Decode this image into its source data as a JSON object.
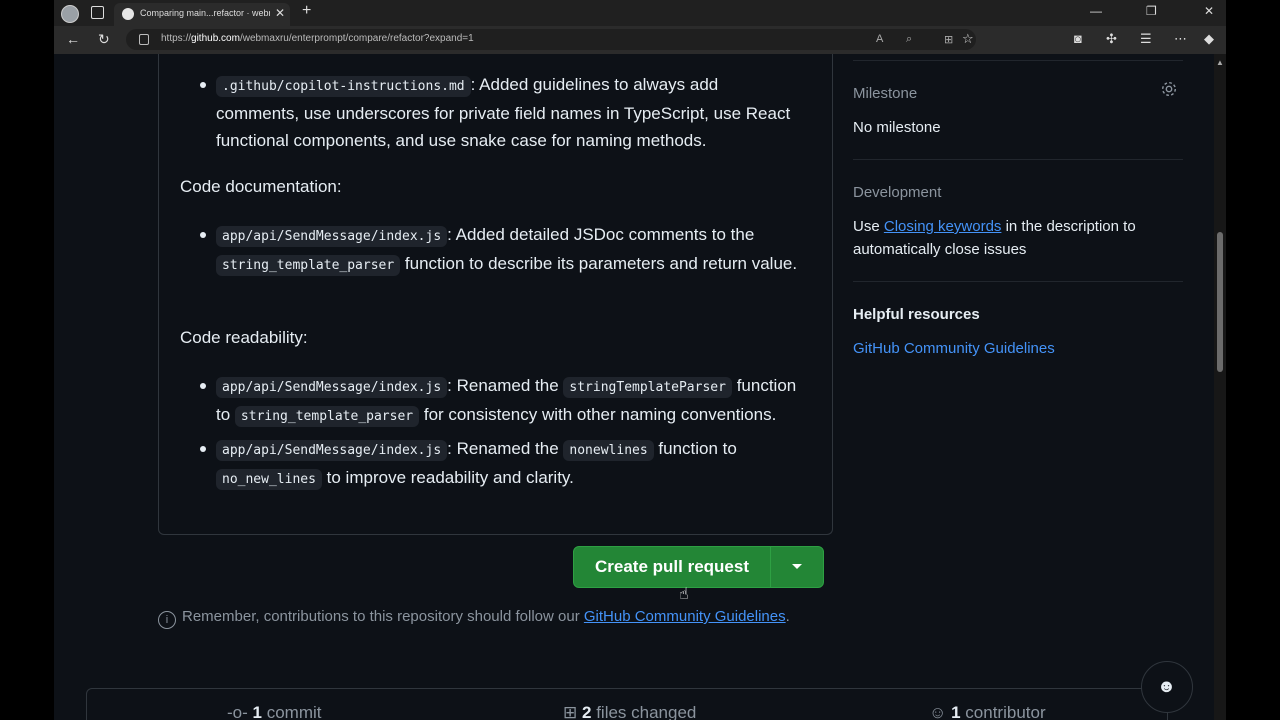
{
  "browser": {
    "tab_title": "Comparing main...refactor · webmaxru/enterprompt",
    "url_prefix": "https://",
    "url_domain": "github.com",
    "url_path": "/webmaxru/enterprompt/compare/refactor?expand=1"
  },
  "description": {
    "item1_code": ".github/copilot-instructions.md",
    "item1_text": ": Added guidelines to always add comments, use underscores for private field names in TypeScript, use React functional components, and use snake case for naming methods.",
    "heading_doc": "Code documentation:",
    "item2_code": "app/api/SendMessage/index.js",
    "item2_text1": ": Added detailed JSDoc comments to the",
    "item2_code2": "string_template_parser",
    "item2_text2": "function to describe its parameters and return value.",
    "heading_read": "Code readability:",
    "item3_code": "app/api/SendMessage/index.js",
    "item3_text1": ": Renamed the",
    "item3_code2": "stringTemplateParser",
    "item3_text2": "function to",
    "item3_code3": "string_template_parser",
    "item3_text3": "for consistency with other naming conventions.",
    "item4_code": "app/api/SendMessage/index.js",
    "item4_text1": ": Renamed the",
    "item4_code2": "nonewlines",
    "item4_text2": "function to",
    "item4_code3": "no_new_lines",
    "item4_text3": "to improve readability and clarity."
  },
  "actions": {
    "create_pr_label": "Create pull request"
  },
  "reminder": {
    "text": "Remember, contributions to this repository should follow our",
    "link": "GitHub Community Guidelines",
    "end": "."
  },
  "sidebar": {
    "milestone_title": "Milestone",
    "milestone_value": "No milestone",
    "development_title": "Development",
    "development_pre": "Use",
    "development_link": "Closing keywords",
    "development_post": "in the description to automatically close issues",
    "helpful_title": "Helpful resources",
    "helpful_link": "GitHub Community Guidelines"
  },
  "stats": {
    "commits_count": "1",
    "commits_label": "commit",
    "files_count": "2",
    "files_label": "files changed",
    "contributors_count": "1",
    "contributors_label": "contributor"
  },
  "colors": {
    "accent_green": "#238636",
    "link_blue": "#4493f8",
    "background": "#0d1117"
  }
}
